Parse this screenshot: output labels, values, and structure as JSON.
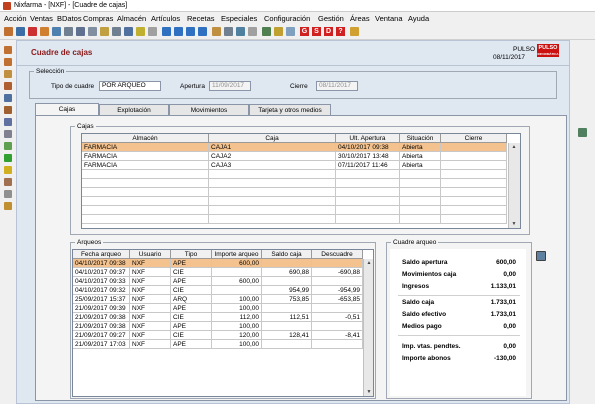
{
  "window": {
    "title": "Nixfarma - [NXF] - [Cuadre de cajas]"
  },
  "menu": [
    "Acción",
    "Ventas",
    "BDatos",
    "Compras",
    "Almacén",
    "Artículos",
    "Recetas",
    "Especiales",
    "Configuración",
    "Gestión",
    "Áreas",
    "Ventana",
    "Ayuda"
  ],
  "toolbar": {
    "g": "G",
    "s": "S",
    "d": "D",
    "q": "?"
  },
  "header": {
    "title": "Cuadre de cajas",
    "user": "PULSO",
    "date": "08/11/2017",
    "logo": "PULSO",
    "logo_sub": "INFORMÁTICA"
  },
  "seleccion": {
    "legend": "Selección",
    "tipo_label": "Tipo de cuadre",
    "tipo_value": "POR ARQUEO",
    "apertura_label": "Apertura",
    "apertura_value": "11/09/2017",
    "cierre_label": "Cierre",
    "cierre_value": "08/11/2017"
  },
  "tabs": [
    "Cajas",
    "Explotación",
    "Movimientos",
    "Tarjeta y otros medios"
  ],
  "cajas": {
    "legend": "Cajas",
    "headers": [
      "Almacén",
      "Caja",
      "Ult. Apertura",
      "Situación",
      "Cierre"
    ],
    "rows": [
      [
        "FARMACIA",
        "CAJA1",
        "04/10/2017 09:38",
        "Abierta",
        ""
      ],
      [
        "FARMACIA",
        "CAJA2",
        "30/10/2017 13:48",
        "Abierta",
        ""
      ],
      [
        "FARMACIA",
        "CAJA3",
        "07/11/2017 11:46",
        "Abierta",
        ""
      ]
    ]
  },
  "arqueos": {
    "legend": "Arqueos",
    "headers": [
      "Fecha arqueo",
      "Usuario",
      "Tipo",
      "Importe arqueo",
      "Saldo caja",
      "Descuadre"
    ],
    "rows": [
      [
        "04/10/2017 09:38",
        "NXF",
        "APE",
        "600,00",
        "",
        ""
      ],
      [
        "04/10/2017 09:37",
        "NXF",
        "CIE",
        "",
        "690,88",
        "-690,88"
      ],
      [
        "04/10/2017 09:33",
        "NXF",
        "APE",
        "600,00",
        "",
        ""
      ],
      [
        "04/10/2017 09:32",
        "NXF",
        "CIE",
        "",
        "954,99",
        "-954,99"
      ],
      [
        "25/09/2017 15:37",
        "NXF",
        "ARQ",
        "100,00",
        "753,85",
        "-653,85"
      ],
      [
        "21/09/2017 09:39",
        "NXF",
        "APE",
        "100,00",
        "",
        ""
      ],
      [
        "21/09/2017 09:38",
        "NXF",
        "CIE",
        "112,00",
        "112,51",
        "-0,51"
      ],
      [
        "21/09/2017 09:38",
        "NXF",
        "APE",
        "100,00",
        "",
        ""
      ],
      [
        "21/09/2017 09:27",
        "NXF",
        "CIE",
        "120,00",
        "128,41",
        "-8,41"
      ],
      [
        "21/09/2017 17:03",
        "NXF",
        "APE",
        "100,00",
        "",
        ""
      ]
    ]
  },
  "cuadre": {
    "legend": "Cuadre arqueo",
    "items": [
      {
        "label": "Saldo apertura",
        "value": "600,00"
      },
      {
        "label": "Movimientos caja",
        "value": "0,00"
      },
      {
        "label": "Ingresos",
        "value": "1.133,01"
      },
      {
        "label": "Saldo caja",
        "value": "1.733,01"
      },
      {
        "label": "Saldo efectivo",
        "value": "1.733,01"
      },
      {
        "label": "Medios pago",
        "value": "0,00"
      },
      {
        "label": "Imp. vtas. pendtes.",
        "value": "0,00"
      },
      {
        "label": "Importe abonos",
        "value": "-130,00"
      }
    ]
  },
  "colors": {
    "selected_row": "#f4c28e",
    "title_red": "#8b1a1a",
    "panel_bg": "#dfe7f1"
  }
}
